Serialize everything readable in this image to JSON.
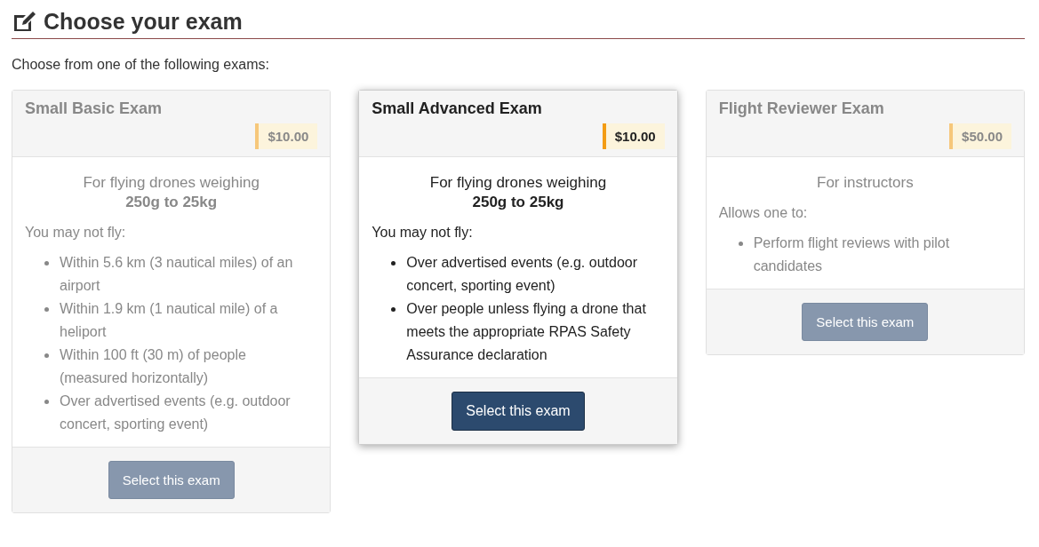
{
  "heading": "Choose your exam",
  "intro": "Choose from one of the following exams:",
  "exams": [
    {
      "title": "Small Basic Exam",
      "price": "$10.00",
      "selected": false,
      "summary": "For flying drones weighing",
      "weight": "250g to 25kg",
      "list_intro": "You may not fly:",
      "items": [
        "Within 5.6 km (3 nautical miles) of an airport",
        "Within 1.9 km (1 nautical mile) of a heliport",
        "Within 100 ft (30 m) of people (measured horizontally)",
        "Over advertised events (e.g. outdoor concert, sporting event)"
      ],
      "button": "Select this exam"
    },
    {
      "title": "Small Advanced Exam",
      "price": "$10.00",
      "selected": true,
      "summary": "For flying drones weighing",
      "weight": "250g to 25kg",
      "list_intro": "You may not fly:",
      "items": [
        "Over advertised events (e.g. outdoor concert, sporting event)",
        "Over people unless flying a drone that meets the appropriate RPAS Safety Assurance declaration"
      ],
      "button": "Select this exam"
    },
    {
      "title": "Flight Reviewer Exam",
      "price": "$50.00",
      "selected": false,
      "summary": "For instructors",
      "list_intro": "Allows one to:",
      "items": [
        "Perform flight reviews with pilot candidates"
      ],
      "button": "Select this exam"
    }
  ]
}
